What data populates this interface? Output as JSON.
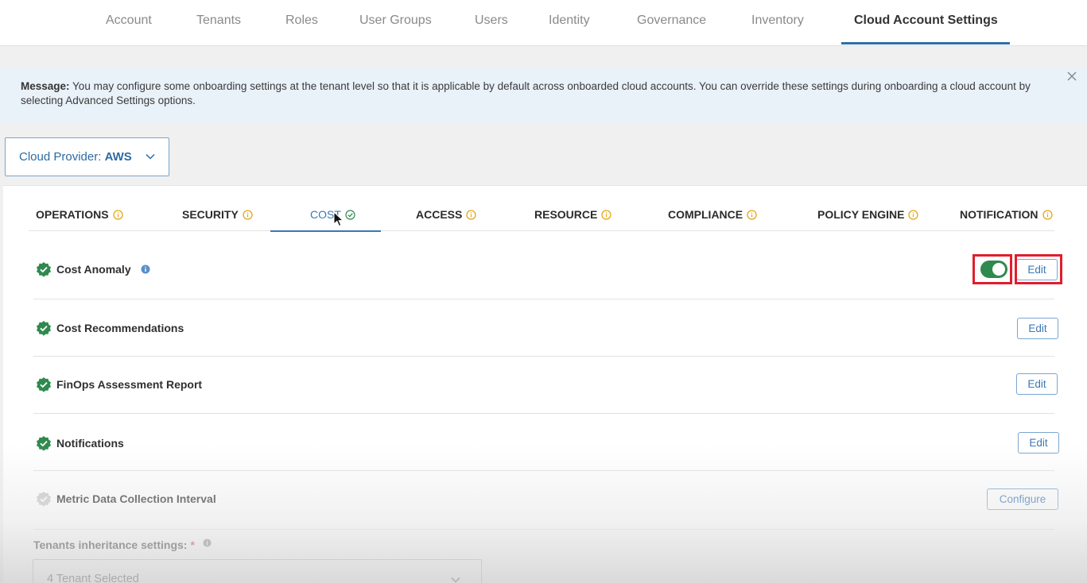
{
  "topnav": {
    "items": [
      "Account",
      "Tenants",
      "Roles",
      "User Groups",
      "Users",
      "Identity",
      "Governance",
      "Inventory",
      "Cloud Account Settings"
    ],
    "active": "Cloud Account Settings"
  },
  "banner": {
    "prefix": "Message:",
    "text": "You may configure some onboarding settings at the tenant level so that it is applicable by default across onboarded cloud accounts. You can override these settings during onboarding a cloud account by selecting Advanced Settings options.",
    "close_icon": "close-icon"
  },
  "provider": {
    "label": "Cloud Provider:",
    "value": "AWS"
  },
  "tabs": [
    {
      "label": "OPERATIONS",
      "status": "warning"
    },
    {
      "label": "SECURITY",
      "status": "warning"
    },
    {
      "label": "COST",
      "status": "ok"
    },
    {
      "label": "ACCESS",
      "status": "warning"
    },
    {
      "label": "RESOURCE",
      "status": "warning"
    },
    {
      "label": "COMPLIANCE",
      "status": "warning"
    },
    {
      "label": "POLICY ENGINE",
      "status": "warning"
    },
    {
      "label": "NOTIFICATION",
      "status": "warning"
    }
  ],
  "active_tab": "COST",
  "settings": [
    {
      "label": "Cost Anomaly",
      "status": "enabled",
      "has_info": true,
      "toggle_on": true,
      "action": "Edit"
    },
    {
      "label": "Cost Recommendations",
      "status": "enabled",
      "action": "Edit"
    },
    {
      "label": "FinOps Assessment Report",
      "status": "enabled",
      "action": "Edit"
    },
    {
      "label": "Notifications",
      "status": "enabled",
      "action": "Edit"
    },
    {
      "label": "Metric Data Collection Interval",
      "status": "disabled",
      "action": "Configure"
    }
  ],
  "inheritance": {
    "label": "Tenants inheritance settings:",
    "required_mark": "*",
    "value": "4 Tenant Selected"
  },
  "colors": {
    "accent": "#3a78b5",
    "success": "#2f8a4d",
    "warning": "#e6a817",
    "highlight": "#e01e2d",
    "banner_bg": "#e9f1f9"
  }
}
